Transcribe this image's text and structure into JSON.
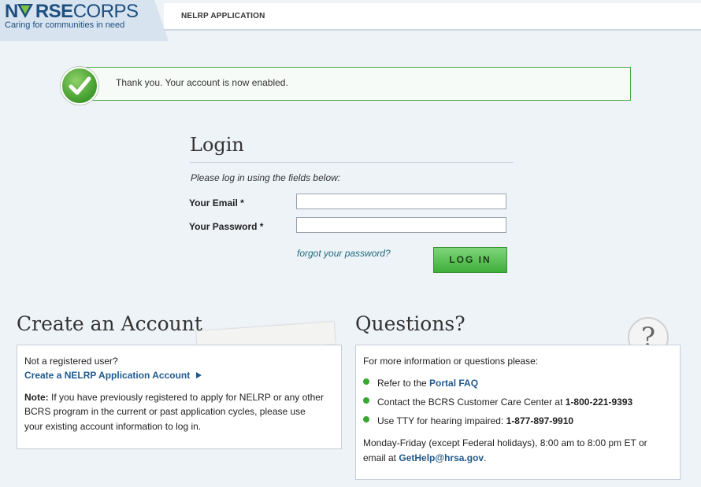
{
  "header": {
    "logo_prefix": "N",
    "logo_main": "RSE",
    "logo_corps": "CORPS",
    "tagline": "Caring for communities in need",
    "app_title": "NELRP APPLICATION"
  },
  "banner": {
    "message": "Thank you. Your account is now enabled."
  },
  "login": {
    "title": "Login",
    "instructions": "Please log in using the fields below:",
    "email_label": "Your Email *",
    "password_label": "Your Password *",
    "email_value": "",
    "password_value": "",
    "forgot_label": "forgot your password?",
    "button_label": "LOG IN"
  },
  "create_account": {
    "title": "Create an Account",
    "not_registered": "Not a registered user?",
    "link_label": "Create a NELRP Application Account",
    "note_label": "Note:",
    "note_line1": "If you have previously registered to apply for NELRP or any other",
    "note_line2": "BCRS program in the current or past application cycles, please use",
    "note_line3": "your existing account information to log in."
  },
  "questions": {
    "title": "Questions?",
    "intro": "For more information or questions please:",
    "item1_prefix": "Refer to the ",
    "item1_link": "Portal FAQ",
    "item2_prefix": "Contact the BCRS Customer Care Center at ",
    "item2_phone": "1-800-221-9393",
    "item3_prefix": "Use TTY for hearing impaired: ",
    "item3_phone": "1-877-897-9910",
    "hours_line": "Monday-Friday (except Federal holidays), 8:00 am to 8:00 pm ET or",
    "email_prefix": "email at ",
    "email_link": "GetHelp@hrsa.gov",
    "email_suffix": "."
  },
  "colors": {
    "brand_blue": "#1d4f80",
    "success_green": "#36a832",
    "link_blue": "#1f5a8f"
  }
}
